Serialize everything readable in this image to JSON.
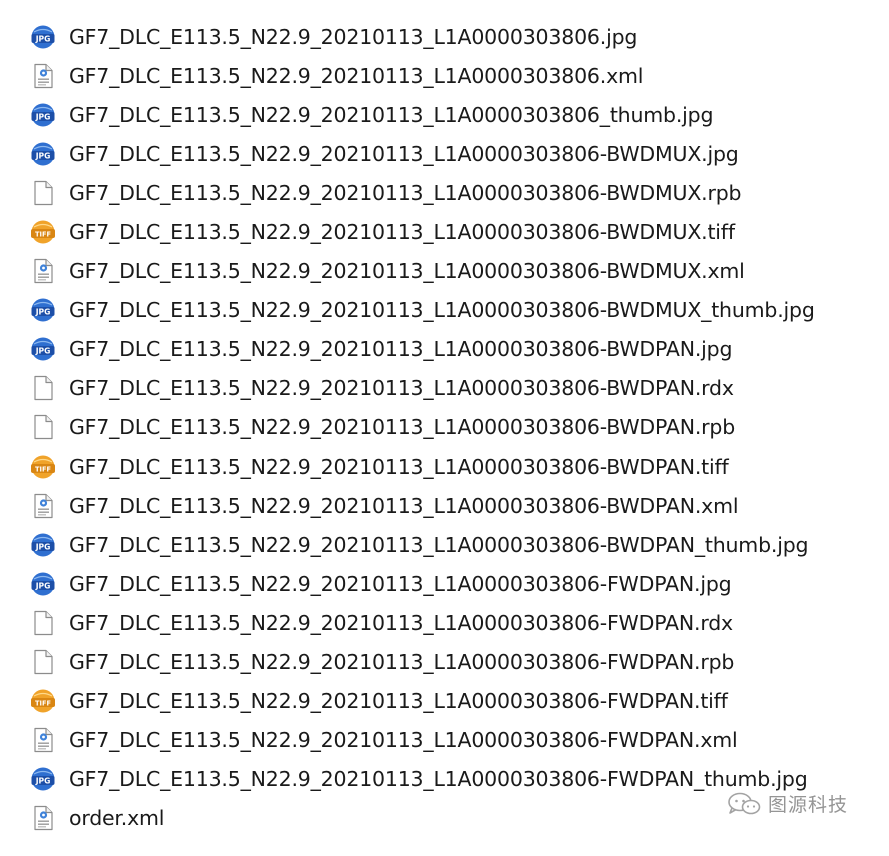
{
  "files": [
    {
      "name": "GF7_DLC_E113.5_N22.9_20210113_L1A0000303806.jpg",
      "icon": "jpg-file-icon"
    },
    {
      "name": "GF7_DLC_E113.5_N22.9_20210113_L1A0000303806.xml",
      "icon": "xml-file-icon"
    },
    {
      "name": "GF7_DLC_E113.5_N22.9_20210113_L1A0000303806_thumb.jpg",
      "icon": "jpg-file-icon"
    },
    {
      "name": "GF7_DLC_E113.5_N22.9_20210113_L1A0000303806-BWDMUX.jpg",
      "icon": "jpg-file-icon"
    },
    {
      "name": "GF7_DLC_E113.5_N22.9_20210113_L1A0000303806-BWDMUX.rpb",
      "icon": "blank-file-icon"
    },
    {
      "name": "GF7_DLC_E113.5_N22.9_20210113_L1A0000303806-BWDMUX.tiff",
      "icon": "tiff-file-icon"
    },
    {
      "name": "GF7_DLC_E113.5_N22.9_20210113_L1A0000303806-BWDMUX.xml",
      "icon": "xml-file-icon"
    },
    {
      "name": "GF7_DLC_E113.5_N22.9_20210113_L1A0000303806-BWDMUX_thumb.jpg",
      "icon": "jpg-file-icon"
    },
    {
      "name": "GF7_DLC_E113.5_N22.9_20210113_L1A0000303806-BWDPAN.jpg",
      "icon": "jpg-file-icon"
    },
    {
      "name": "GF7_DLC_E113.5_N22.9_20210113_L1A0000303806-BWDPAN.rdx",
      "icon": "blank-file-icon"
    },
    {
      "name": "GF7_DLC_E113.5_N22.9_20210113_L1A0000303806-BWDPAN.rpb",
      "icon": "blank-file-icon"
    },
    {
      "name": "GF7_DLC_E113.5_N22.9_20210113_L1A0000303806-BWDPAN.tiff",
      "icon": "tiff-file-icon"
    },
    {
      "name": "GF7_DLC_E113.5_N22.9_20210113_L1A0000303806-BWDPAN.xml",
      "icon": "xml-file-icon"
    },
    {
      "name": "GF7_DLC_E113.5_N22.9_20210113_L1A0000303806-BWDPAN_thumb.jpg",
      "icon": "jpg-file-icon"
    },
    {
      "name": "GF7_DLC_E113.5_N22.9_20210113_L1A0000303806-FWDPAN.jpg",
      "icon": "jpg-file-icon"
    },
    {
      "name": "GF7_DLC_E113.5_N22.9_20210113_L1A0000303806-FWDPAN.rdx",
      "icon": "blank-file-icon"
    },
    {
      "name": "GF7_DLC_E113.5_N22.9_20210113_L1A0000303806-FWDPAN.rpb",
      "icon": "blank-file-icon"
    },
    {
      "name": "GF7_DLC_E113.5_N22.9_20210113_L1A0000303806-FWDPAN.tiff",
      "icon": "tiff-file-icon"
    },
    {
      "name": "GF7_DLC_E113.5_N22.9_20210113_L1A0000303806-FWDPAN.xml",
      "icon": "xml-file-icon"
    },
    {
      "name": "GF7_DLC_E113.5_N22.9_20210113_L1A0000303806-FWDPAN_thumb.jpg",
      "icon": "jpg-file-icon"
    },
    {
      "name": "order.xml",
      "icon": "xml-file-icon"
    }
  ],
  "icon_labels": {
    "jpg": "JPG",
    "tiff": "TIFF"
  },
  "colors": {
    "jpg_blue": "#2f6fd0",
    "tiff_orange": "#f0a32a",
    "xml_blue": "#3f82d9",
    "text": "#1a1a1a",
    "watermark_gray": "#8a8a8a"
  },
  "watermark": {
    "text": "图源科技",
    "icon": "wechat-icon"
  }
}
